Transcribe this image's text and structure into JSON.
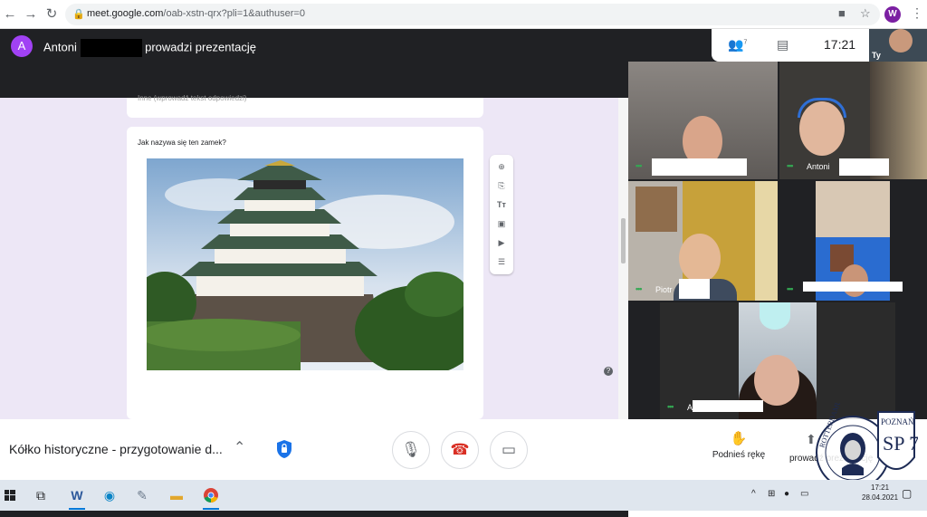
{
  "browser": {
    "url_host": "meet.google.com",
    "url_path": "/oab-xstn-qrx?pli=1&authuser=0",
    "profile_initial": "W"
  },
  "meet": {
    "presenter_initial": "A",
    "presenter_first": "Antoni",
    "presenter_suffix": "prowadzi prezentację",
    "time": "17:21",
    "people_count": "7",
    "self_label": "Ty",
    "meeting_title": "Kółko historyczne - przygotowanie d...",
    "raise_hand": "Podnieś rękę",
    "present_now": "prowadź prezentację"
  },
  "form": {
    "prev_item": "Inne (wprowadź tekst odpowiedzi)",
    "question": "Jak nazywa się ten zamek?"
  },
  "participants": [
    {
      "name": ""
    },
    {
      "name": "Antoni"
    },
    {
      "name": "Piotr"
    },
    {
      "name": ""
    },
    {
      "name": "A"
    }
  ],
  "stamp": {
    "left_text": "ROTTERDAMU",
    "right_text": "POZNAŃ",
    "school": "SP 7",
    "bottom_text": "Z ROTTERDAMU"
  },
  "taskbar": {
    "time": "17:21",
    "date": "28.04.2021"
  },
  "colors": {
    "meet_dark": "#202124",
    "form_bg": "#ede7f6",
    "end_call": "#d93025",
    "avatar": "#a142f4"
  }
}
